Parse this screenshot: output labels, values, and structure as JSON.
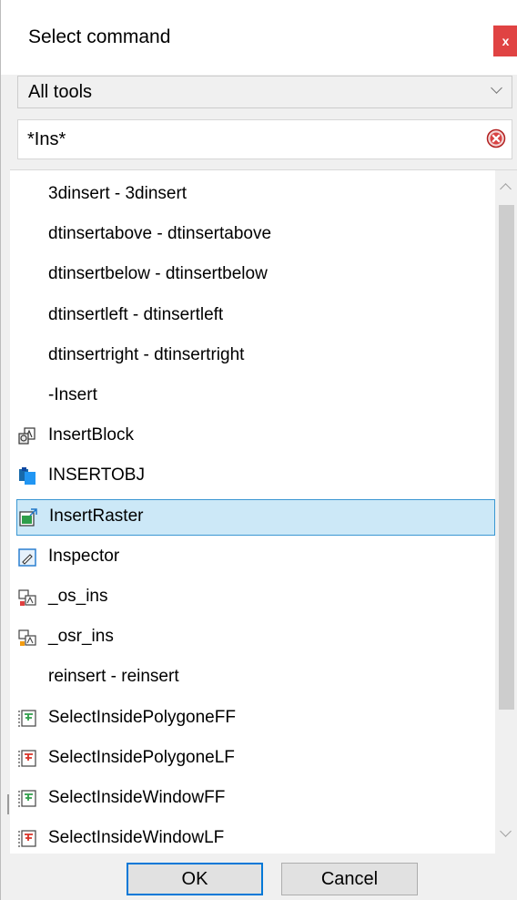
{
  "dialog": {
    "title": "Select command",
    "close_label": "x"
  },
  "tool_filter": {
    "selected": "All tools"
  },
  "search": {
    "value": "*Ins*"
  },
  "commands": [
    {
      "label": "3dinsert - 3dinsert",
      "icon": "none",
      "selected": false
    },
    {
      "label": "dtinsertabove - dtinsertabove",
      "icon": "none",
      "selected": false
    },
    {
      "label": "dtinsertbelow - dtinsertbelow",
      "icon": "none",
      "selected": false
    },
    {
      "label": "dtinsertleft - dtinsertleft",
      "icon": "none",
      "selected": false
    },
    {
      "label": "dtinsertright - dtinsertright",
      "icon": "none",
      "selected": false
    },
    {
      "label": "-Insert",
      "icon": "none",
      "selected": false
    },
    {
      "label": "InsertBlock",
      "icon": "insert-block-icon",
      "selected": false
    },
    {
      "label": "INSERTOBJ",
      "icon": "insert-object-icon",
      "selected": false
    },
    {
      "label": "InsertRaster",
      "icon": "insert-raster-icon",
      "selected": true
    },
    {
      "label": "Inspector",
      "icon": "inspector-icon",
      "selected": false
    },
    {
      "label": "_os_ins",
      "icon": "osnap-insert-icon",
      "selected": false
    },
    {
      "label": "_osr_ins",
      "icon": "osnap-running-insert-icon",
      "selected": false
    },
    {
      "label": "reinsert - reinsert",
      "icon": "none",
      "selected": false
    },
    {
      "label": "SelectInsidePolygoneFF",
      "icon": "select-inside-polygon-ff-icon",
      "selected": false
    },
    {
      "label": "SelectInsidePolygoneLF",
      "icon": "select-inside-polygon-lf-icon",
      "selected": false
    },
    {
      "label": "SelectInsideWindowFF",
      "icon": "select-inside-window-ff-icon",
      "selected": false
    },
    {
      "label": "SelectInsideWindowLF",
      "icon": "select-inside-window-lf-icon",
      "selected": false
    }
  ],
  "buttons": {
    "ok": "OK",
    "cancel": "Cancel"
  },
  "colors": {
    "close_bg": "#e04343",
    "selection_bg": "#cce8f7",
    "selection_border": "#3a97d3",
    "accent": "#0078d7"
  }
}
